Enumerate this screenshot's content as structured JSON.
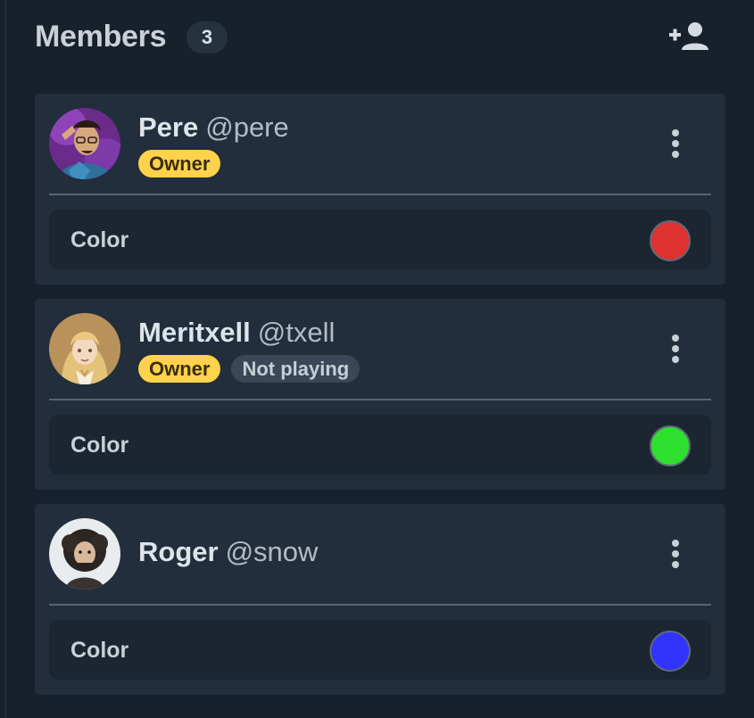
{
  "header": {
    "title": "Members",
    "count": "3",
    "add_member_icon": "person-add-icon"
  },
  "members": [
    {
      "name": "Pere",
      "handle": "@pere",
      "tags": [
        "Owner"
      ],
      "color_label": "Color",
      "color": "#e03131",
      "avatar_icon": "avatar-pere"
    },
    {
      "name": "Meritxell",
      "handle": "@txell",
      "tags": [
        "Owner",
        "Not playing"
      ],
      "color_label": "Color",
      "color": "#2ee02e",
      "avatar_icon": "avatar-meritxell"
    },
    {
      "name": "Roger",
      "handle": "@snow",
      "tags": [],
      "color_label": "Color",
      "color": "#3333ff",
      "avatar_icon": "avatar-roger"
    }
  ],
  "colors": {
    "background": "#17202b",
    "card": "#222e3b",
    "owner_tag": "#fed24a",
    "status_tag": "#3b4756"
  }
}
